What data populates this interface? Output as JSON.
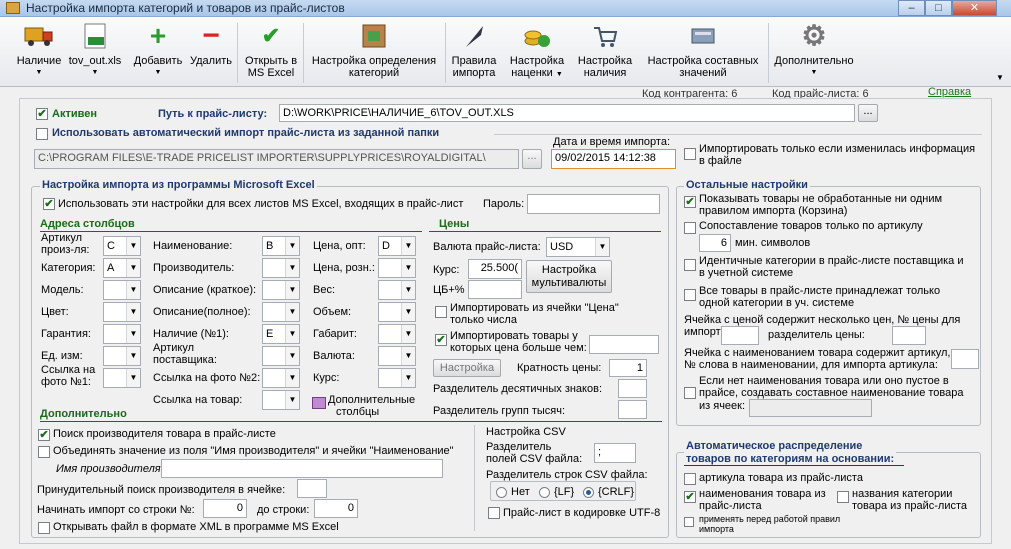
{
  "window": {
    "title": "Настройка импорта категорий и товаров из прайс-листов",
    "minimize": "–",
    "maximize": "□",
    "close": "✕"
  },
  "toolbar": [
    {
      "line1": "Наличие",
      "line2": "",
      "icon": "truck-icon"
    },
    {
      "line1": "tov_out.xls",
      "line2": "",
      "icon": "xls-file-icon"
    },
    {
      "line1": "Добавить",
      "line2": "",
      "icon": "plus-icon"
    },
    {
      "line1": "Удалить",
      "line2": "",
      "icon": "minus-icon"
    },
    {
      "line1": "Открыть в",
      "line2": "MS Excel",
      "icon": "checkmark-icon"
    },
    {
      "line1": "Настройка определения",
      "line2": "категорий",
      "icon": "category-icon"
    },
    {
      "line1": "Правила",
      "line2": "импорта",
      "icon": "quill-icon"
    },
    {
      "line1": "Настройка",
      "line2": "наценки",
      "icon": "coins-icon"
    },
    {
      "line1": "Настройка",
      "line2": "наличия",
      "icon": "cart-icon"
    },
    {
      "line1": "Настройка составных",
      "line2": "значений",
      "icon": "keyboard-icon"
    },
    {
      "line1": "Дополнительно",
      "line2": "",
      "icon": "gear-icon"
    }
  ],
  "dropdown_glyph": "▼",
  "status": {
    "contractor": "Код контрагента: 6",
    "pricelist": "Код прайс-листа: 6",
    "help": "Справка"
  },
  "top": {
    "active_label": "Активен",
    "path_label": "Путь к прайс-листу:",
    "path_value": "D:\\WORK\\PRICE\\НАЛИЧИЕ_6\\TOV_OUT.XLS",
    "browse": "...",
    "auto_import_label": "Использовать автоматический импорт прайс-листа из заданной папки",
    "auto_path": "C:\\PROGRAM FILES\\E-TRADE PRICELIST IMPORTER\\SUPPLYPRICES\\ROYALDIGITAL\\",
    "date_label": "Дата и время импорта:",
    "date_value": "09/02/2015 14:12:38",
    "only_changed_1": "Импортировать только если изменилась информация",
    "only_changed_2": "в файле"
  },
  "excel": {
    "title": "Настройка импорта из программы Microsoft Excel",
    "use_all": "Использовать эти настройки для всех листов MS Excel, входящих в прайс-лист",
    "password_label": "Пароль:"
  },
  "columns": {
    "title": "Адреса столбцов",
    "c1": [
      {
        "l1": "Артикул",
        "l2": "произ-ля:",
        "v": "C"
      },
      {
        "l1": "Категория:",
        "l2": "",
        "v": "A"
      },
      {
        "l1": "Модель:",
        "l2": "",
        "v": ""
      },
      {
        "l1": "Цвет:",
        "l2": "",
        "v": ""
      },
      {
        "l1": "Гарантия:",
        "l2": "",
        "v": ""
      },
      {
        "l1": "Ед. изм:",
        "l2": "",
        "v": ""
      },
      {
        "l1": "Ссылка на",
        "l2": "фото №1:",
        "v": ""
      }
    ],
    "c2": [
      {
        "l1": "Наименование:",
        "l2": "",
        "v": "B"
      },
      {
        "l1": "Производитель:",
        "l2": "",
        "v": ""
      },
      {
        "l1": "Описание (краткое):",
        "l2": "",
        "v": ""
      },
      {
        "l1": "Описание(полное):",
        "l2": "",
        "v": ""
      },
      {
        "l1": "Наличие (№1):",
        "l2": "",
        "v": "E"
      },
      {
        "l1": "Артикул",
        "l2": "поставщика:",
        "v": ""
      },
      {
        "l1": "Ссылка на фото №2:",
        "l2": "",
        "v": ""
      },
      {
        "l1": "Ссылка на товар:",
        "l2": "",
        "v": ""
      }
    ],
    "c3": [
      {
        "l1": "Цена, опт:",
        "l2": "",
        "v": "D"
      },
      {
        "l1": "Цена, розн.:",
        "l2": "",
        "v": ""
      },
      {
        "l1": "Вес:",
        "l2": "",
        "v": ""
      },
      {
        "l1": "Объем:",
        "l2": "",
        "v": ""
      },
      {
        "l1": "Габарит:",
        "l2": "",
        "v": ""
      },
      {
        "l1": "Валюта:",
        "l2": "",
        "v": ""
      },
      {
        "l1": "Курс:",
        "l2": "",
        "v": ""
      }
    ],
    "extra_l1": "Дополнительные",
    "extra_l2": "столбцы"
  },
  "prices": {
    "title": "Цены",
    "currency_label": "Валюта прайс-листа:",
    "currency": "USD",
    "rate_label": "Курс:",
    "rate": "25.500(",
    "cb_label": "ЦБ+%",
    "multicurrency_1": "Настройка",
    "multicurrency_2": "мультивалюты",
    "import_cell_1": "Импортировать из ячейки \"Цена\"",
    "import_cell_2": "только числа",
    "import_gt_1": "Импортировать товары у",
    "import_gt_2": "которых цена больше чем:",
    "setting_btn": "Настройка",
    "multiplicity_label": "Кратность цены:",
    "multiplicity": "1",
    "dec_sep": "Разделитель десятичных знаков:",
    "thou_sep": "Разделитель групп тысяч:"
  },
  "extra": {
    "title": "Дополнительно",
    "search_mfr": "Поиск производителя товара в прайс-листе",
    "merge_1": "Объединять значение из поля \"Имя производителя\" и ячейки \"Наименование\"",
    "mfr_name": "Имя производителя:",
    "force_search": "Принудительный поиск производителя в ячейке:",
    "start_row": "Начинать импорт со строки №:",
    "start_val": "0",
    "to_row": "до строки:",
    "to_val": "0",
    "open_xml": "Открывать файл в формате XML в программе MS Excel"
  },
  "csv": {
    "title": "Настройка CSV",
    "field_sep_1": "Разделитель",
    "field_sep_2": "полей CSV файла:",
    "field_sep": ";",
    "row_sep": "Разделитель строк CSV файла:",
    "opt_none": "Нет",
    "opt_lf": "{LF}",
    "opt_crlf": "{CRLF}",
    "utf8": "Прайс-лист в кодировке UTF-8"
  },
  "other": {
    "title": "Остальные настройки",
    "show_unprocessed_1": "Показывать товары не обработанные ни одним",
    "show_unprocessed_2": "правилом импорта (Корзина)",
    "match_article": "Сопоставление товаров только по артикулу",
    "min_val": "6",
    "min_label": "мин. символов",
    "ident_1": "Идентичные категории в прайс-листе поставщика и",
    "ident_2": "в учетной системе",
    "one_cat_1": "Все товары в прайс-листе принадлежат только",
    "one_cat_2": "одной категории в уч. системе",
    "multi_price_1": "Ячейка с ценой содержит несколько цен, № цены для",
    "multi_price_2": "импорта:",
    "price_sep": "разделитель цены:",
    "name_art_1": "Ячейка с наименованием товара содержит артикул,",
    "name_art_2": "№ слова в наименовании, для импорта артикула:",
    "compose_1": "Если нет наименования товара или оно пустое в",
    "compose_2": "прайсе, создавать составное наименование товара",
    "compose_3": "из ячеек:"
  },
  "auto": {
    "title_1": "Автоматическое распределение",
    "title_2": "товаров по категориям на основании:",
    "by_article": "артикула товара из прайс-листа",
    "by_name_1": "наименования товара из",
    "by_name_2": "прайс-листа",
    "by_cat_1": "названия  категории",
    "by_cat_2": "товара из прайс-листа",
    "apply_1": "применять перед работой правил",
    "apply_2": "импорта"
  },
  "checkmark": "✔"
}
